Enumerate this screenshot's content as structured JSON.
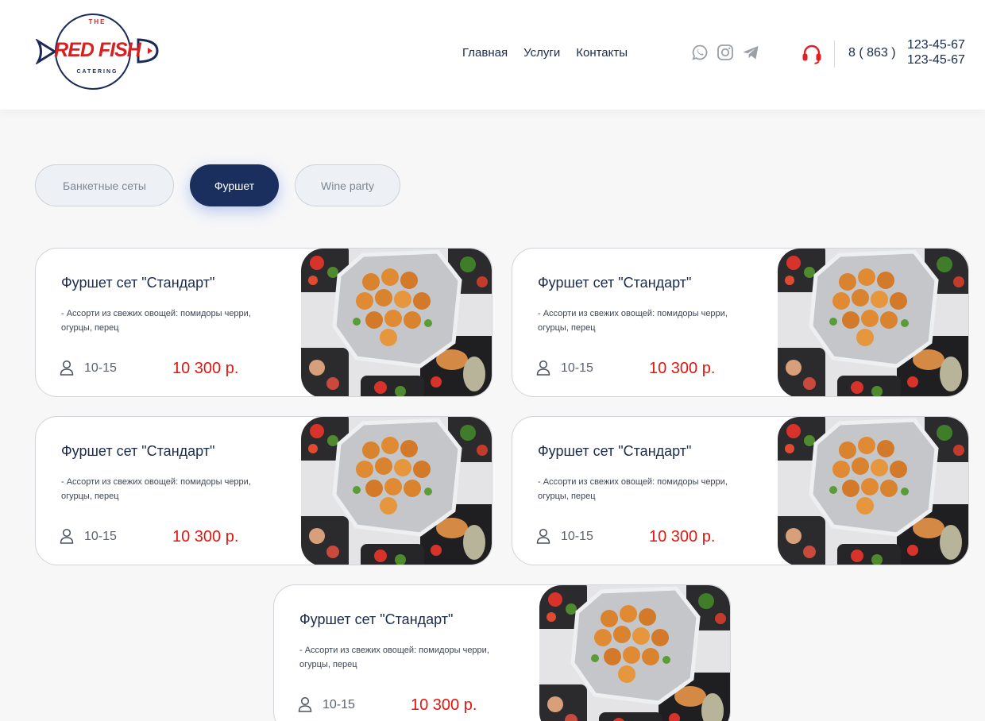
{
  "brand": {
    "logo_top": "THE",
    "logo_main": "RED FISH",
    "logo_sub": "CATERING"
  },
  "nav": [
    {
      "label": "Главная"
    },
    {
      "label": "Услуги"
    },
    {
      "label": "Контакты"
    }
  ],
  "social_icons": [
    "whatsapp-icon",
    "instagram-icon",
    "telegram-icon"
  ],
  "contact": {
    "support_icon": "headset-icon",
    "code": "8 ( 863 )",
    "phones": [
      "123-45-67",
      "123-45-67"
    ]
  },
  "tabs": [
    {
      "label": "Банкетные сеты",
      "active": false
    },
    {
      "label": "Фуршет",
      "active": true
    },
    {
      "label": "Wine party",
      "active": false
    }
  ],
  "cards": [
    {
      "title": "Фуршет сет \"Стандарт\"",
      "description": "- Ассорти из свежих овощей: помидоры черри, огурцы, перец",
      "guests": "10-15",
      "price": "10 300 р."
    },
    {
      "title": "Фуршет сет \"Стандарт\"",
      "description": "- Ассорти из свежих овощей: помидоры черри, огурцы, перец",
      "guests": "10-15",
      "price": "10 300 р."
    },
    {
      "title": "Фуршет сет \"Стандарт\"",
      "description": "- Ассорти из свежих овощей: помидоры черри, огурцы, перец",
      "guests": "10-15",
      "price": "10 300 р."
    },
    {
      "title": "Фуршет сет \"Стандарт\"",
      "description": "- Ассорти из свежих овощей: помидоры черри, огурцы, перец",
      "guests": "10-15",
      "price": "10 300 р."
    },
    {
      "title": "Фуршет сет \"Стандарт\"",
      "description": "- Ассорти из свежих овощей: помидоры черри, огурцы, перец",
      "guests": "10-15",
      "price": "10 300 р."
    }
  ],
  "colors": {
    "brand_red": "#d92020",
    "navy": "#1b2f5e",
    "price_red": "#e3150f",
    "support_red": "#e31e24",
    "tab_inactive_bg": "#edf0f4"
  }
}
